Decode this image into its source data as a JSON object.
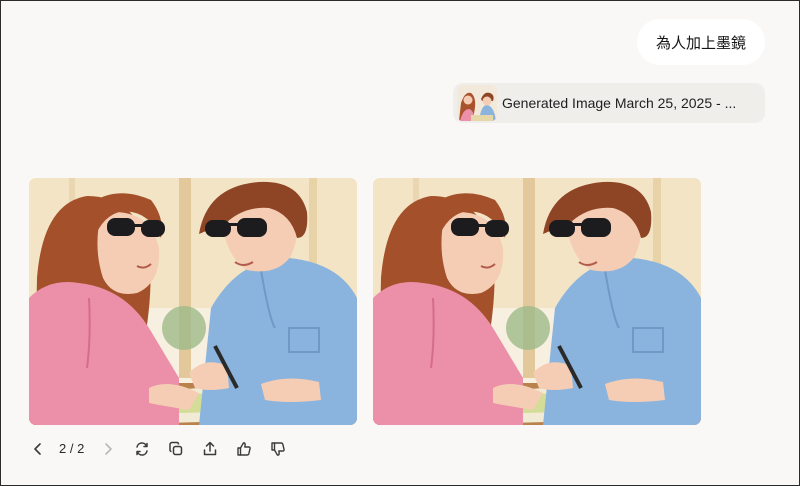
{
  "conversation": {
    "user_message": "為人加上墨鏡",
    "attachment_label": "Generated Image March 25, 2025 - ...",
    "attachment_thumbnail_icon": "generated-image-thumbnail"
  },
  "images": [
    {
      "name": "generated-image-1",
      "description_icon": "couple-with-sunglasses-illustration"
    },
    {
      "name": "generated-image-2",
      "description_icon": "couple-with-sunglasses-illustration"
    }
  ],
  "toolbar": {
    "pager": "2 / 2",
    "icons": {
      "prev": "chevron-left-icon",
      "next": "chevron-right-icon",
      "regenerate": "refresh-icon",
      "copy": "copy-icon",
      "share": "share-icon",
      "like": "thumbs-up-icon",
      "dislike": "thumbs-down-icon"
    }
  },
  "colors": {
    "background": "#f9f8f6",
    "bubble": "#ffffff",
    "attachment": "#efeeeb",
    "woman_shirt": "#ec8fa8",
    "man_shirt": "#8ab4dd",
    "hair": "#a4502b"
  }
}
